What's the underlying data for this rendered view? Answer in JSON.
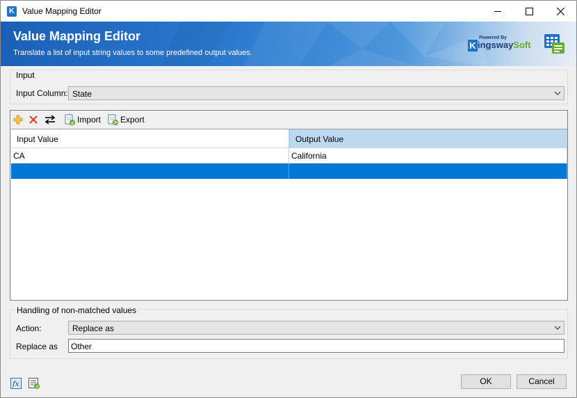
{
  "window": {
    "title": "Value Mapping Editor",
    "app_icon_letter": "K"
  },
  "banner": {
    "title": "Value Mapping Editor",
    "subtitle": "Translate a list of input string values to some predefined output values.",
    "brand_powered": "Powered By",
    "brand_k": "K",
    "brand_name_prefix": "ingsway",
    "brand_name_suffix": "Soft"
  },
  "input_group": {
    "label": "Input",
    "column_label": "Input Column:",
    "column_value": "State"
  },
  "toolbar": {
    "import_label": "Import",
    "export_label": "Export"
  },
  "grid": {
    "headers": [
      "Input Value",
      "Output Value"
    ],
    "rows": [
      {
        "input": "CA",
        "output": "California"
      },
      {
        "input": "",
        "output": ""
      }
    ]
  },
  "nonmatched": {
    "label": "Handling of non-matched values",
    "action_label": "Action:",
    "action_value": "Replace as",
    "replace_label": "Replace as",
    "replace_value": "Other"
  },
  "buttons": {
    "ok": "OK",
    "cancel": "Cancel"
  },
  "colors": {
    "banner_blue": "#1b5fb6",
    "selection_blue": "#0078d7",
    "header_highlight": "#bcd9f0",
    "brand_green": "#6aaa2e"
  }
}
